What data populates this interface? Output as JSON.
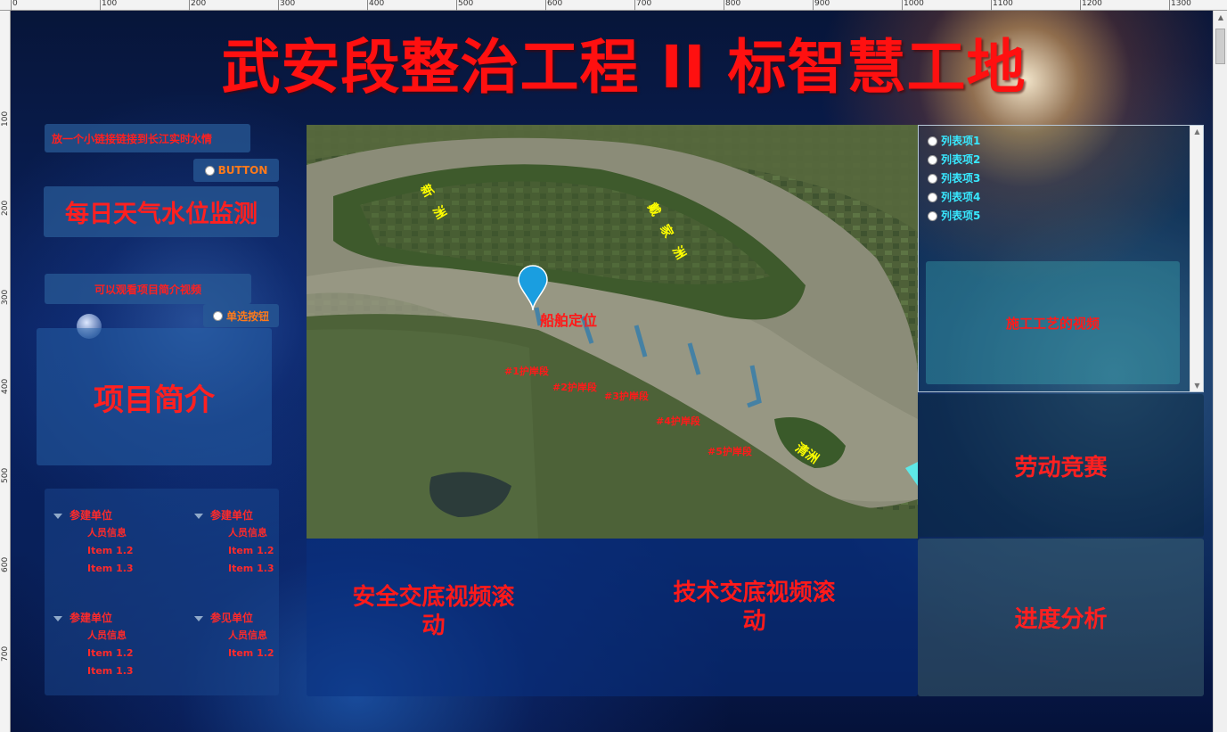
{
  "title": "武安段整治工程 II 标智慧工地",
  "ruler_top": [
    "0",
    "100",
    "200",
    "300",
    "400",
    "500",
    "600",
    "700",
    "800",
    "900",
    "1000",
    "1100",
    "1200",
    "1300"
  ],
  "ruler_left": [
    "100",
    "200",
    "300",
    "400",
    "500",
    "600",
    "700"
  ],
  "left": {
    "link_button": "放一个小链接链接到长江实时水情",
    "button": "BUTTON",
    "weather_panel": "每日天气水位监测",
    "video_button": "可以观看项目简介视频",
    "radio_label": "单选按钮",
    "intro_panel": "项目简介"
  },
  "tree_groups": [
    {
      "label": "参建单位",
      "items": [
        "人员信息",
        "Item 1.2",
        "Item 1.3"
      ]
    },
    {
      "label": "参建单位",
      "items": [
        "人员信息",
        "Item 1.2",
        "Item 1.3"
      ]
    },
    {
      "label": "参建单位",
      "items": [
        "人员信息",
        "Item 1.2",
        "Item 1.3"
      ]
    },
    {
      "label": "参见单位",
      "items": [
        "人员信息",
        "Item 1.2"
      ]
    }
  ],
  "map": {
    "ship_label": "船舶定位",
    "island_labels": [
      "新洲",
      "戴家洲",
      "清洲"
    ],
    "site_labels": [
      "#1护岸段",
      "#2护岸段",
      "#3护岸段",
      "#4护岸段",
      "#5护岸段"
    ]
  },
  "list": {
    "items": [
      "列表项1",
      "列表项2",
      "列表项3",
      "列表项4",
      "列表项5"
    ],
    "video_label": "施工工艺的视频"
  },
  "right": {
    "labor": "劳动竞赛",
    "progress": "进度分析"
  },
  "bottom": {
    "safety": "安全交底视频滚动",
    "tech": "技术交底视频滚动"
  },
  "colors": {
    "accent": "#ff1a1a",
    "list_text": "#38e8ff",
    "map_label": "#ffff00"
  }
}
